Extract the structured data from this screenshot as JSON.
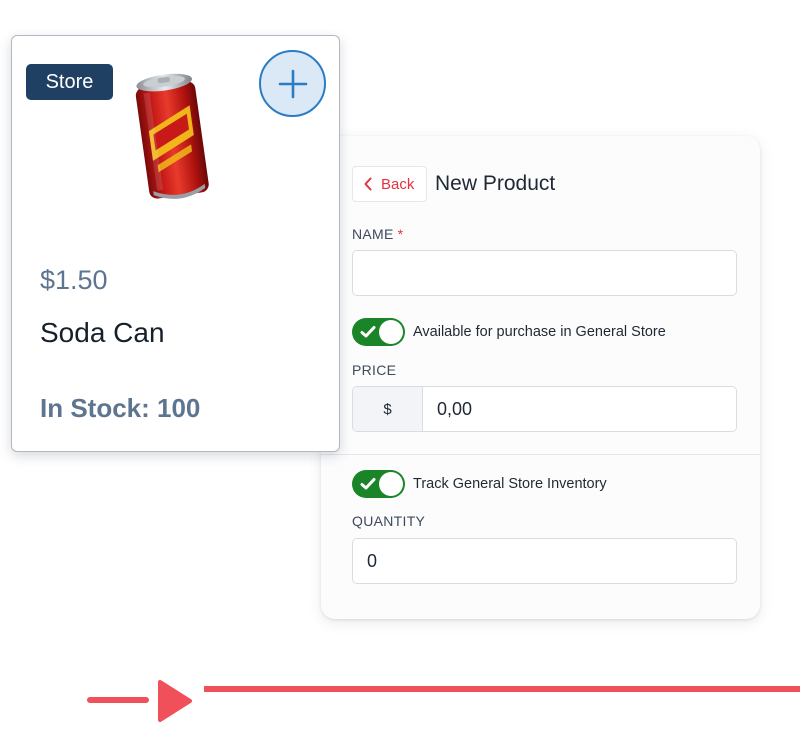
{
  "product_card": {
    "badge": "Store",
    "price": "$1.50",
    "name": "Soda Can",
    "stock": "In Stock: 100",
    "add_icon": "plus-icon",
    "image": "soda-can-image"
  },
  "form": {
    "back_label": "Back",
    "back_icon": "chevron-left-icon",
    "title": "New Product",
    "name_label": "NAME",
    "name_required_mark": "*",
    "name_value": "",
    "available_toggle": {
      "label": "Available for purchase in General Store",
      "on": true
    },
    "price_label": "PRICE",
    "price_prefix": "$",
    "price_value": "0,00",
    "track_toggle": {
      "label": "Track General Store Inventory",
      "on": true
    },
    "quantity_label": "QUANTITY",
    "quantity_value": "0"
  },
  "colors": {
    "accent_red": "#e0343f",
    "toggle_green": "#198428",
    "badge_navy": "#1f4063",
    "add_blue": "#2c7cc4",
    "muted_slate": "#5e7590"
  }
}
